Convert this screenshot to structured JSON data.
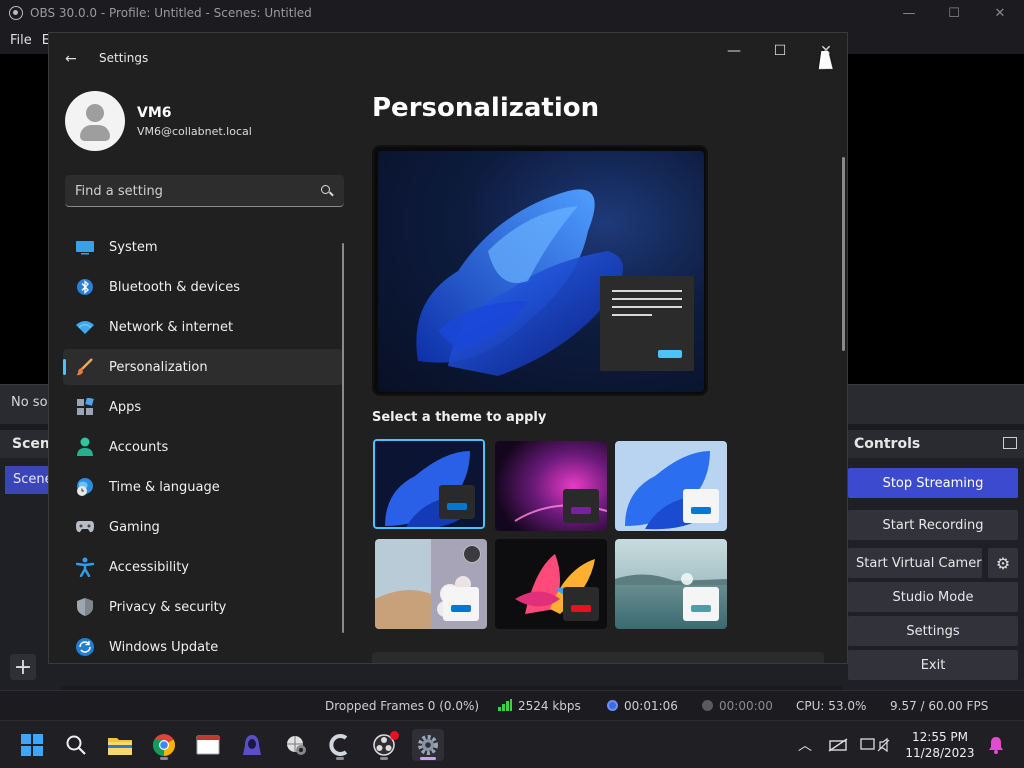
{
  "obs": {
    "title": "OBS 30.0.0 - Profile: Untitled - Scenes: Untitled",
    "menu_file": "File",
    "menu_edit_partial": "E",
    "no_source": "No so",
    "scenes_header": "Scene",
    "scene_item": "Scene",
    "controls_header": "Controls",
    "controls": {
      "stop_streaming": "Stop Streaming",
      "start_recording": "Start Recording",
      "start_virtual_camera": "Start Virtual Camera",
      "studio_mode": "Studio Mode",
      "settings": "Settings",
      "exit": "Exit"
    },
    "status": {
      "dropped_frames": "Dropped Frames 0 (0.0%)",
      "bitrate": "2524 kbps",
      "stream_time": "00:01:06",
      "record_time": "00:00:00",
      "cpu": "CPU: 53.0%",
      "fps": "9.57 / 60.00 FPS"
    }
  },
  "settings": {
    "window_title": "Settings",
    "user": {
      "name": "VM6",
      "email": "VM6@collabnet.local"
    },
    "search_placeholder": "Find a setting",
    "nav": [
      {
        "label": "System",
        "icon": "system-icon"
      },
      {
        "label": "Bluetooth & devices",
        "icon": "bluetooth-icon"
      },
      {
        "label": "Network & internet",
        "icon": "wifi-icon"
      },
      {
        "label": "Personalization",
        "icon": "brush-icon",
        "selected": true
      },
      {
        "label": "Apps",
        "icon": "apps-icon"
      },
      {
        "label": "Accounts",
        "icon": "person-icon"
      },
      {
        "label": "Time & language",
        "icon": "globe-clock-icon"
      },
      {
        "label": "Gaming",
        "icon": "gamepad-icon"
      },
      {
        "label": "Accessibility",
        "icon": "accessibility-icon"
      },
      {
        "label": "Privacy & security",
        "icon": "shield-icon"
      },
      {
        "label": "Windows Update",
        "icon": "update-icon"
      }
    ],
    "page_title": "Personalization",
    "theme_section_label": "Select a theme to apply",
    "accent_color": "#4cc2ff"
  },
  "taskbar": {
    "time": "12:55 PM",
    "date": "11/28/2023"
  }
}
